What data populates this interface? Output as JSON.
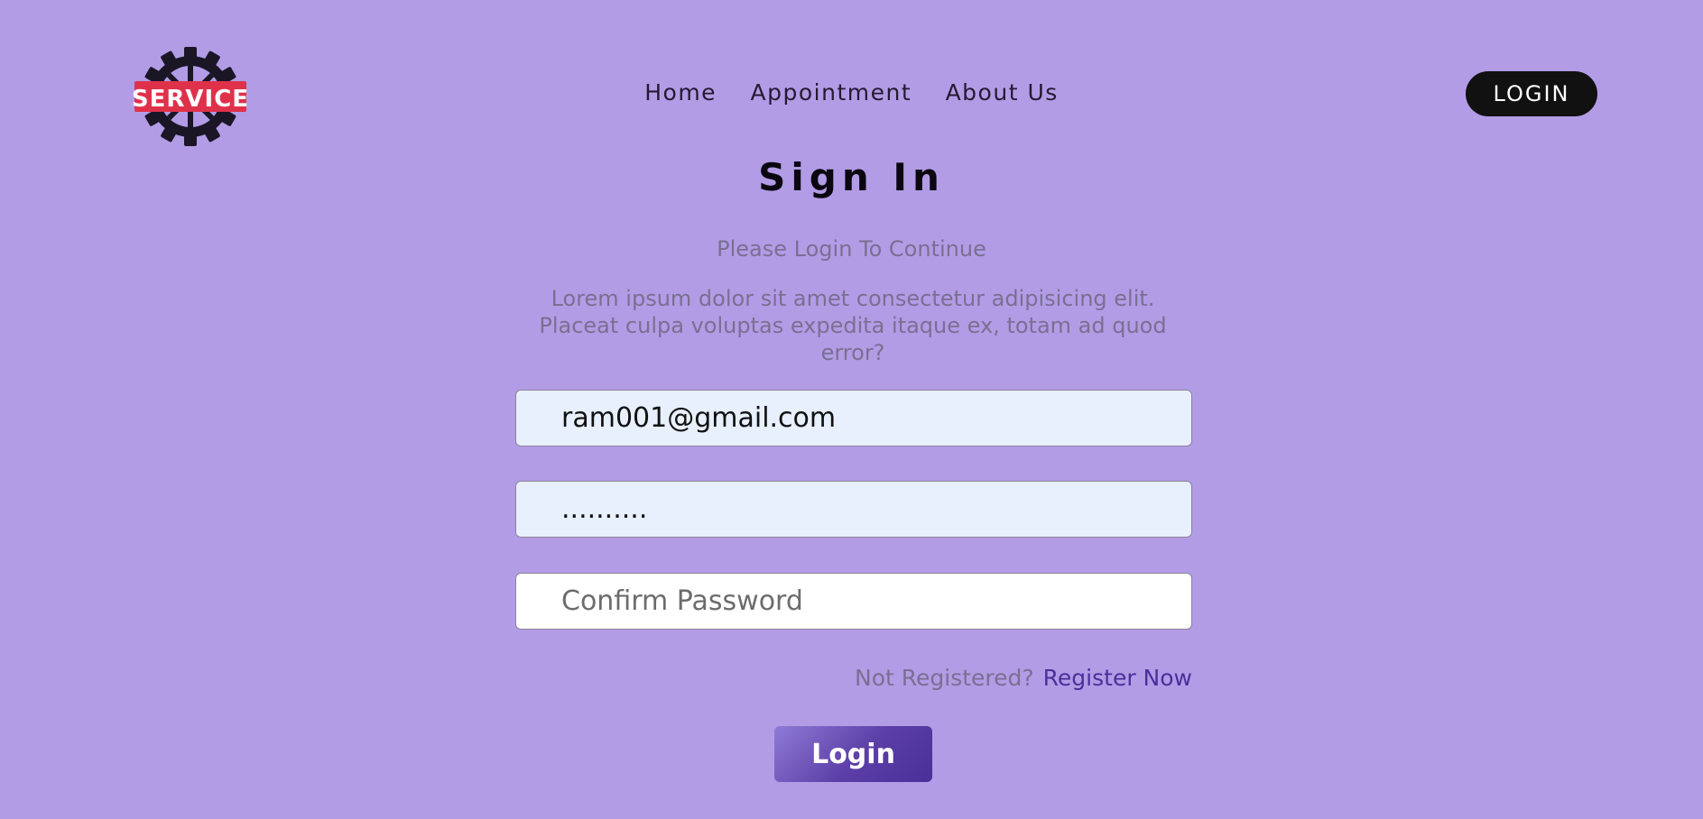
{
  "header": {
    "logo_text": "SERVICE",
    "nav": [
      {
        "label": "Home"
      },
      {
        "label": "Appointment"
      },
      {
        "label": "About Us"
      }
    ],
    "login_label": "LOGIN"
  },
  "form": {
    "title": "Sign In",
    "subtitle": "Please Login To Continue",
    "description": "Lorem ipsum dolor sit amet consectetur adipisicing elit. Placeat culpa voluptas expedita itaque ex, totam ad quod error?",
    "email_value": "ram001@gmail.com",
    "password_value": "..........",
    "confirm_placeholder": "Confirm Password",
    "not_registered": "Not Registered?",
    "register_link": "Register Now",
    "submit_label": "Login"
  },
  "colors": {
    "background": "#b39ce6",
    "logo_red": "#e0314a",
    "logo_dark": "#1a1626",
    "link": "#4b2f9b",
    "button_start": "#8f7bd6",
    "button_end": "#4a2f99"
  },
  "icons": {
    "logo": "service-gear-logo"
  }
}
